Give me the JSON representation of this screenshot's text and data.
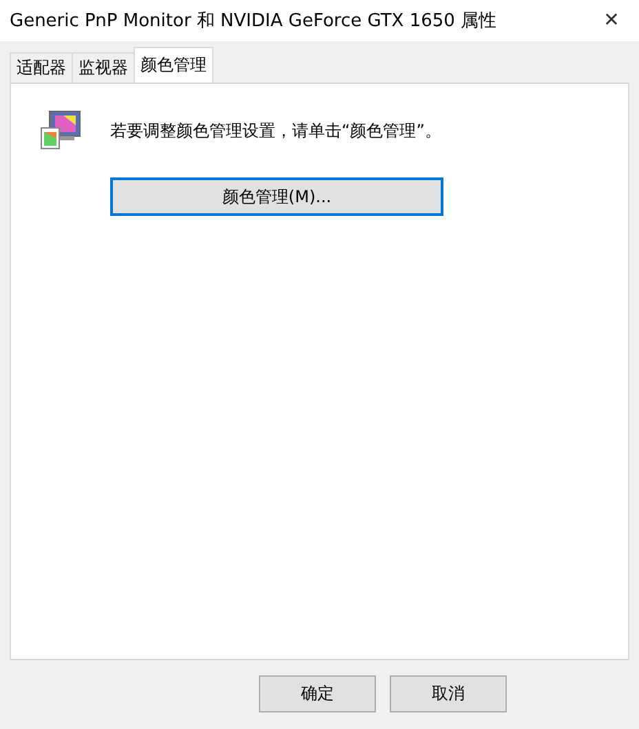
{
  "window": {
    "title": "Generic PnP Monitor 和 NVIDIA GeForce GTX 1650 属性",
    "close": "✕"
  },
  "tabs": [
    {
      "label": "适配器",
      "selected": false
    },
    {
      "label": "监视器",
      "selected": false
    },
    {
      "label": "颜色管理",
      "selected": true
    }
  ],
  "panel": {
    "description": "若要调整颜色管理设置，请单击“颜色管理”。",
    "button": "颜色管理(M)..."
  },
  "buttons": [
    "确定",
    "取消"
  ]
}
